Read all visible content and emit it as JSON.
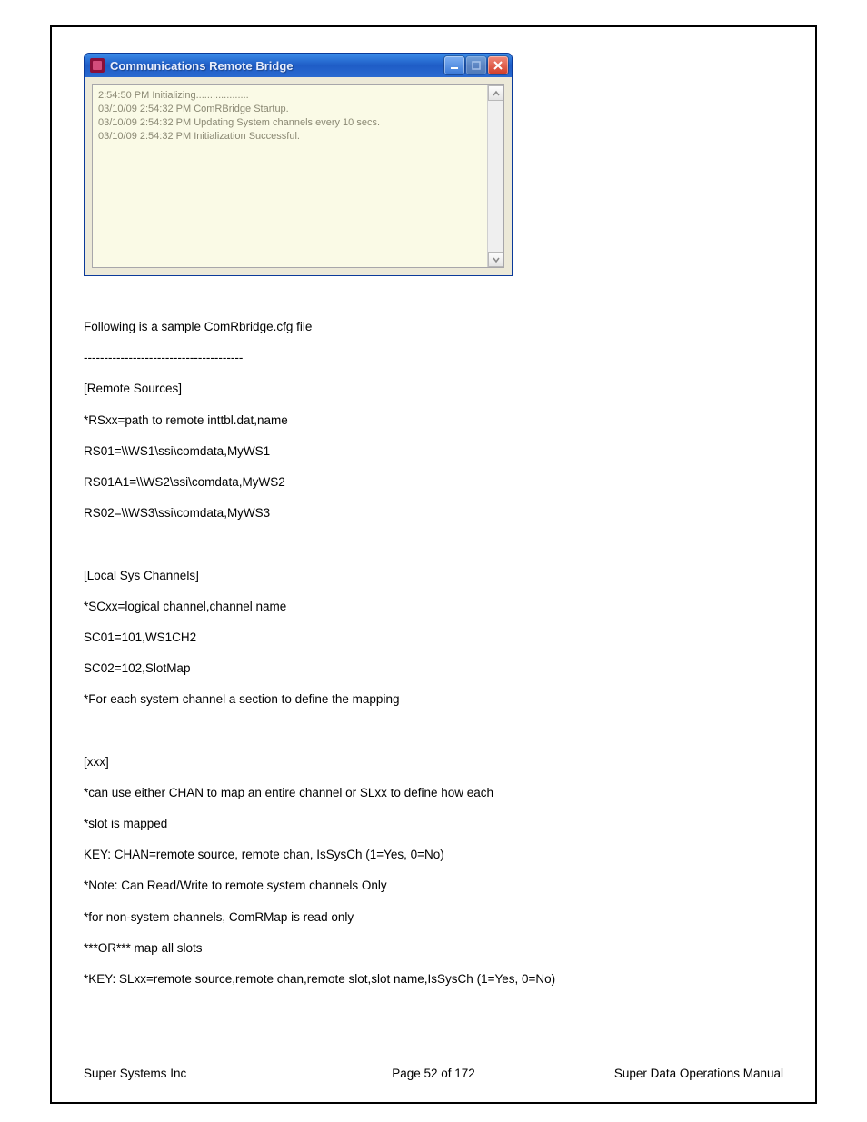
{
  "window": {
    "title": "Communications Remote Bridge",
    "log_lines": [
      "2:54:50 PM Initializing...................",
      "03/10/09 2:54:32 PM ComRBridge Startup.",
      "03/10/09 2:54:32 PM Updating System channels every 10 secs.",
      "03/10/09 2:54:32 PM Initialization Successful."
    ]
  },
  "doc": {
    "lines": [
      "Following is a sample ComRbridge.cfg file",
      "---------------------------------------",
      "[Remote Sources]",
      "*RSxx=path to remote inttbl.dat,name",
      "RS01=\\\\WS1\\ssi\\comdata,MyWS1",
      "RS01A1=\\\\WS2\\ssi\\comdata,MyWS2",
      "RS02=\\\\WS3\\ssi\\comdata,MyWS3",
      "",
      "[Local Sys Channels]",
      "*SCxx=logical channel,channel name",
      "SC01=101,WS1CH2",
      "SC02=102,SlotMap",
      "*For each system channel a section to define the mapping",
      "",
      "[xxx]",
      "*can use either CHAN to map an entire channel or SLxx to define how each",
      "*slot is mapped",
      "KEY: CHAN=remote source, remote chan, IsSysCh (1=Yes, 0=No)",
      "*Note: Can Read/Write to remote system channels Only",
      "*for non-system channels, ComRMap is read only",
      "***OR*** map all slots",
      "*KEY: SLxx=remote source,remote chan,remote slot,slot name,IsSysCh (1=Yes, 0=No)"
    ]
  },
  "footer": {
    "left": "Super Systems Inc",
    "center": "Page 52 of 172",
    "right": "Super Data Operations Manual"
  }
}
